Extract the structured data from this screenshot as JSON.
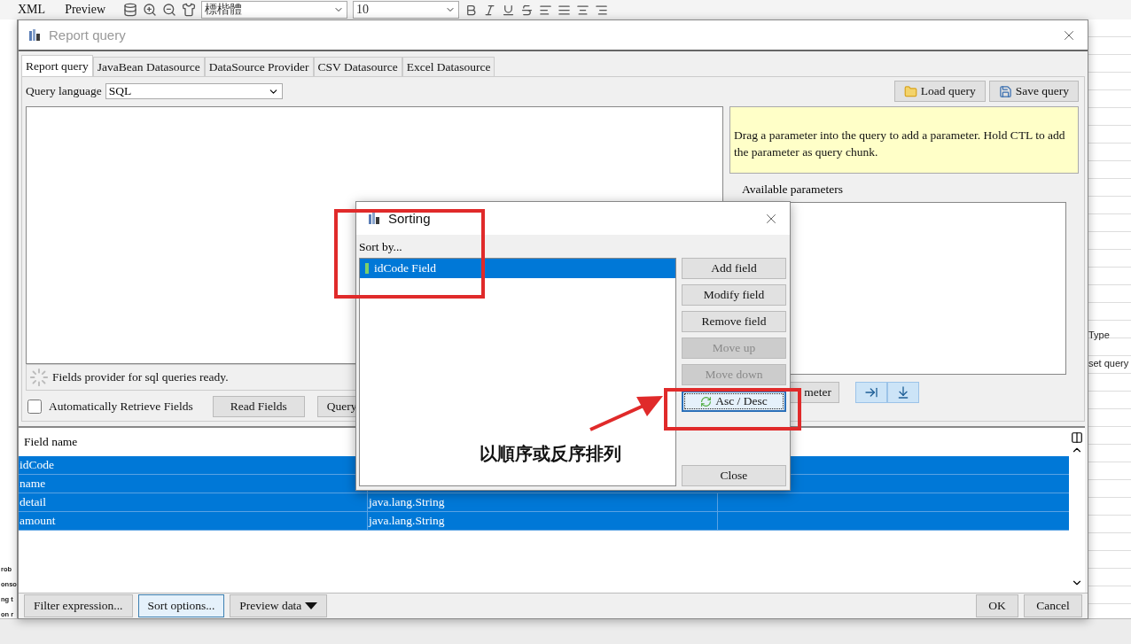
{
  "app": {
    "toolbar_tabs": [
      "XML",
      "Preview"
    ],
    "font": "標楷體",
    "font_size": "10",
    "side_texts": [
      "rob",
      "onso",
      "ng t",
      "on r"
    ],
    "property_texts": [
      "Type",
      "set query"
    ]
  },
  "report_query": {
    "title": "Report query",
    "tabs": [
      {
        "label": "Report query",
        "selected": true
      },
      {
        "label": "JavaBean Datasource",
        "selected": false
      },
      {
        "label": "DataSource Provider",
        "selected": false
      },
      {
        "label": "CSV Datasource",
        "selected": false
      },
      {
        "label": "Excel Datasource",
        "selected": false
      }
    ],
    "query_language_label": "Query language",
    "query_language": "SQL",
    "load_button": "Load query",
    "save_button": "Save query",
    "hint": "Drag a parameter into the query to add a parameter. Hold CTL to add the parameter as query chunk.",
    "available_parameters_label": "Available parameters",
    "parameter_button": "meter",
    "status": "Fields provider for sql queries ready.",
    "auto_retrieve": {
      "label": "Automatically Retrieve Fields",
      "checked": false
    },
    "read_fields_button": "Read Fields",
    "query_button": "Query",
    "table": {
      "columns": [
        "Field name"
      ],
      "rows": [
        {
          "name": "idCode",
          "selected": true
        },
        {
          "name": "name",
          "selected": true
        },
        {
          "name": "detail",
          "type": "java.lang.String",
          "selected": true
        },
        {
          "name": "amount",
          "type": "java.lang.String",
          "selected": true
        }
      ]
    },
    "bottom_buttons": [
      {
        "label": "Filter expression...",
        "kind": "plain",
        "selected": false
      },
      {
        "label": "Sort options...",
        "kind": "plain",
        "selected": true
      },
      {
        "label": "Preview data",
        "kind": "dropdown",
        "selected": false
      }
    ],
    "ok_button": "OK",
    "cancel_button": "Cancel"
  },
  "sorting": {
    "title": "Sorting",
    "sort_by_label": "Sort by...",
    "items": [
      {
        "label": "idCode Field",
        "selected": true
      }
    ],
    "buttons": [
      {
        "label": "Add field",
        "disabled": false,
        "focused": false,
        "kind": "plain"
      },
      {
        "label": "Modify field",
        "disabled": false,
        "focused": false,
        "kind": "plain"
      },
      {
        "label": "Remove field",
        "disabled": false,
        "focused": false,
        "kind": "plain"
      },
      {
        "label": "Move up",
        "disabled": true,
        "focused": false,
        "kind": "plain"
      },
      {
        "label": "Move down",
        "disabled": true,
        "focused": false,
        "kind": "plain"
      },
      {
        "label": "Asc / Desc",
        "disabled": false,
        "focused": true,
        "kind": "toggle"
      }
    ],
    "close_button": "Close"
  },
  "annotation": {
    "caption": "以順序或反序排列"
  }
}
